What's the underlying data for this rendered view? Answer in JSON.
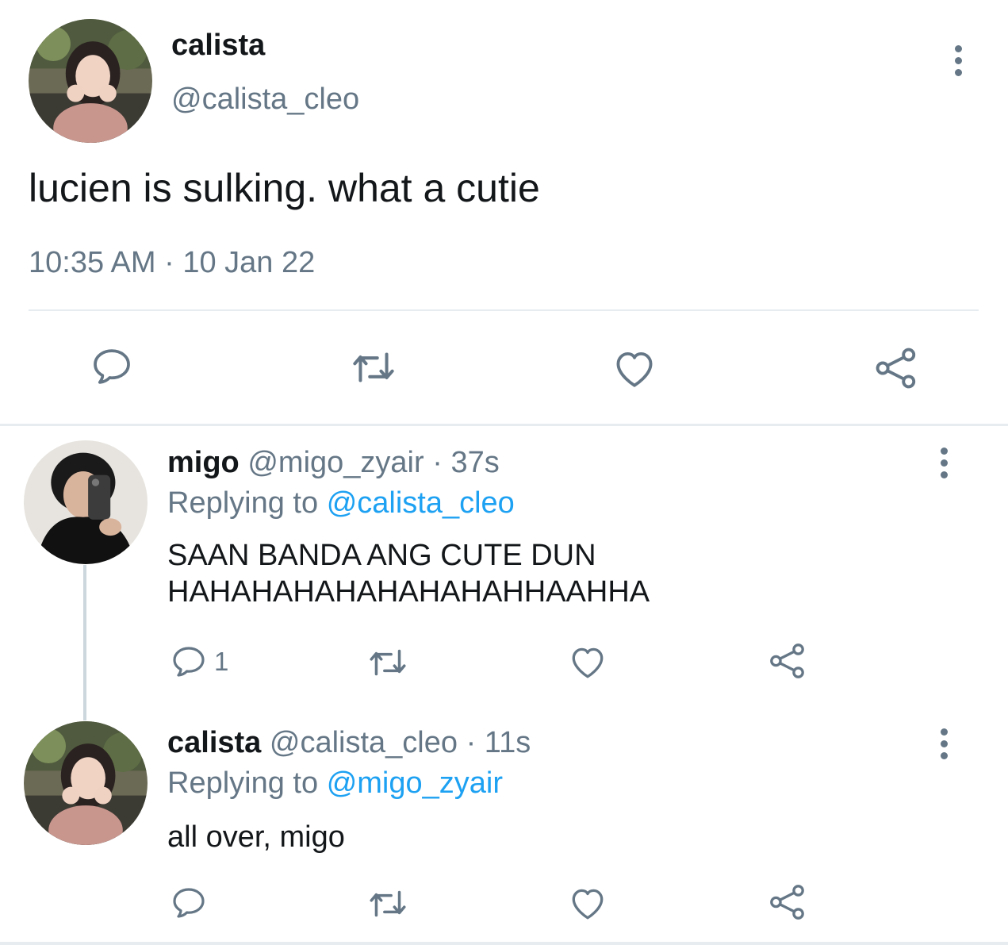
{
  "main_tweet": {
    "name": "calista",
    "handle": "@calista_cleo",
    "text": "lucien is sulking. what a cutie",
    "time": "10:35 AM",
    "separator": "·",
    "date": "10 Jan 22"
  },
  "replies": [
    {
      "name": "migo",
      "handle": "@migo_zyair",
      "separator": "·",
      "age": "37s",
      "replying_prefix": "Replying to",
      "replying_to": "@calista_cleo",
      "text_line1": "SAAN BANDA ANG CUTE DUN",
      "text_line2": "HAHAHAHAHAHAHAHAHHAAHHA",
      "reply_count": "1"
    },
    {
      "name": "calista",
      "handle": "@calista_cleo",
      "separator": "·",
      "age": "11s",
      "replying_prefix": "Replying to",
      "replying_to": "@migo_zyair",
      "text_line1": "all over, migo"
    }
  ],
  "icons": {
    "reply": "reply-icon",
    "retweet": "retweet-icon",
    "like": "heart-icon",
    "share": "share-icon",
    "more": "more-vertical-icon"
  },
  "colors": {
    "text": "#14171a",
    "secondary": "#657786",
    "mention": "#1da1f2",
    "divider": "#e6ecf0"
  }
}
